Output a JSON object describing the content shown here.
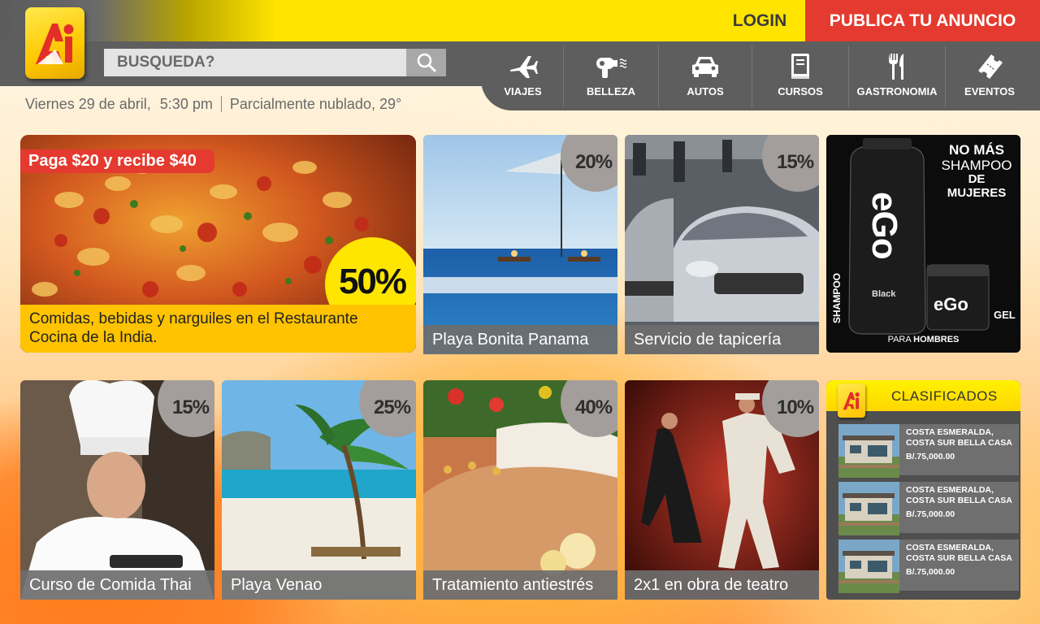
{
  "header": {
    "login_label": "LOGIN",
    "publish_label": "PUBLICA TU ANUNCIO",
    "search_placeholder": "BUSQUEDA?",
    "date": "Viernes 29 de abril,",
    "time": "5:30 pm",
    "weather": "Parcialmente nublado, 29°"
  },
  "nav": [
    {
      "label": "VIAJES",
      "icon": "airplane-icon"
    },
    {
      "label": "BELLEZA",
      "icon": "hair-dryer-icon"
    },
    {
      "label": "AUTOS",
      "icon": "car-icon"
    },
    {
      "label": "CURSOS",
      "icon": "book-icon"
    },
    {
      "label": "GASTRONOMIA",
      "icon": "fork-knife-icon"
    },
    {
      "label": "EVENTOS",
      "icon": "ticket-icon"
    }
  ],
  "featured": {
    "promo": "Paga $20 y recibe $40",
    "discount": "50%",
    "caption_line1": "Comidas, bebidas y narguiles en el Restaurante",
    "caption_line2": "Cocina de la India."
  },
  "deals_top": [
    {
      "caption": "Playa Bonita Panama",
      "discount": "20%"
    },
    {
      "caption": "Servicio de tapicería",
      "discount": "15%"
    }
  ],
  "ad": {
    "headline_1": "NO MÁS",
    "headline_2": "SHAMPOO",
    "headline_3": "DE MUJERES",
    "brand": "eGo",
    "side_text": "SHAMPOO",
    "variant": "Black",
    "gel": "GEL",
    "footer_1": "PARA ",
    "footer_2": "HOMBRES"
  },
  "deals_bottom": [
    {
      "caption": "Curso de Comida Thai",
      "discount": "15%"
    },
    {
      "caption": "Playa Venao",
      "discount": "25%"
    },
    {
      "caption": "Tratamiento antiestrés",
      "discount": "40%"
    },
    {
      "caption": "2x1 en obra de teatro",
      "discount": "10%"
    }
  ],
  "classifieds": {
    "title": "CLASIFICADOS",
    "items": [
      {
        "title": "COSTA ESMERALDA, COSTA SUR BELLA CASA",
        "price": "B/.75,000.00"
      },
      {
        "title": "COSTA ESMERALDA, COSTA SUR BELLA CASA",
        "price": "B/.75,000.00"
      },
      {
        "title": "COSTA ESMERALDA, COSTA SUR BELLA CASA",
        "price": "B/.75,000.00"
      }
    ]
  },
  "colors": {
    "accent_red": "#e43a2f",
    "accent_yellow": "#ffe400",
    "header_gray": "#5e5e5e"
  }
}
